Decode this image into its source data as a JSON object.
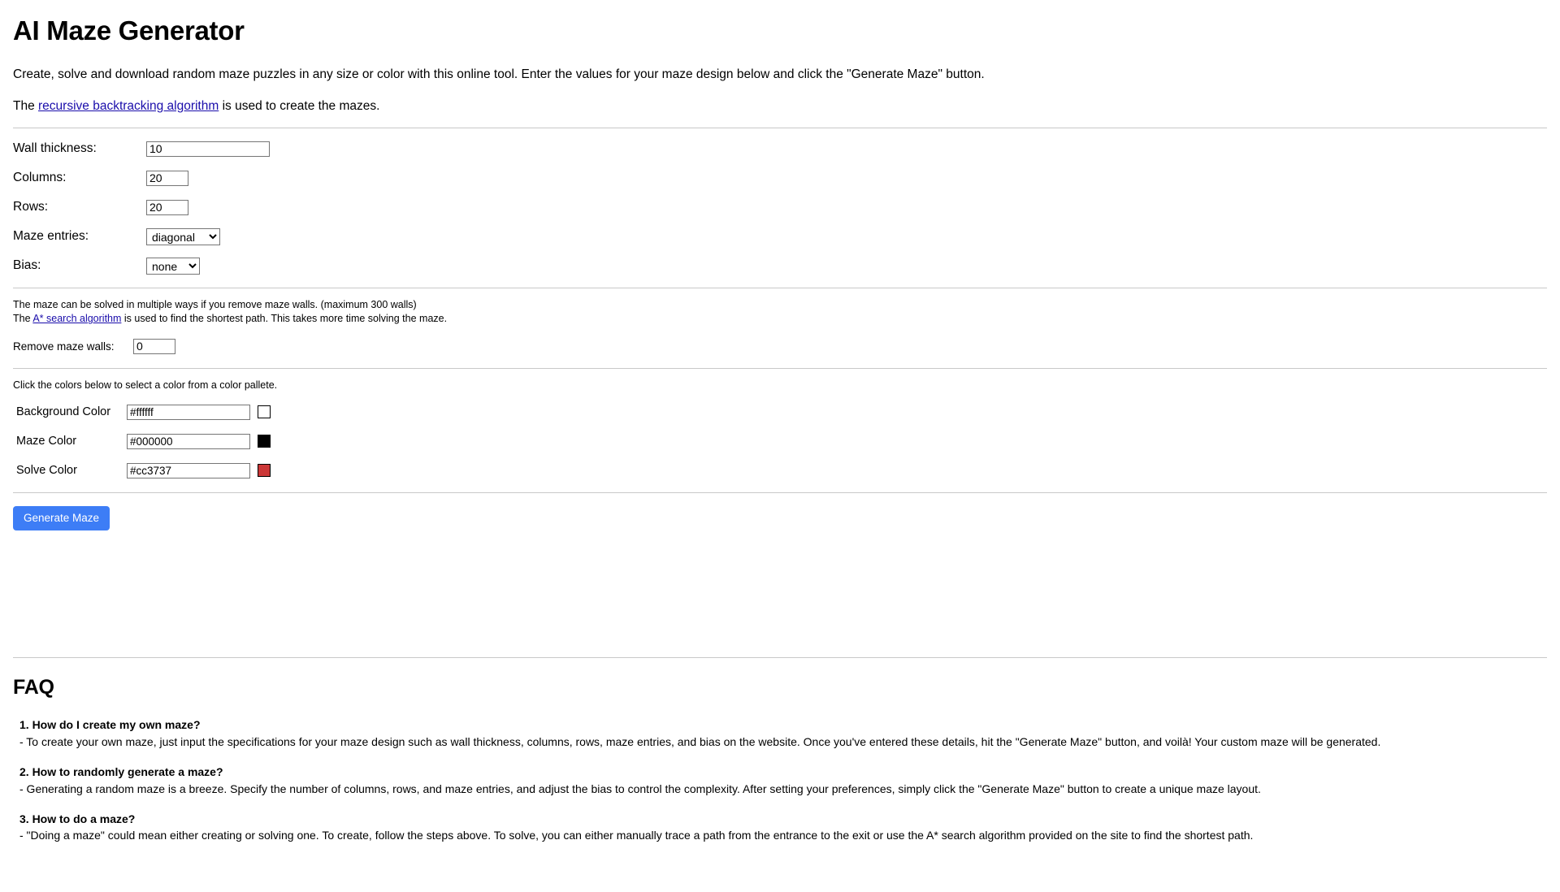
{
  "page": {
    "title": "AI Maze Generator",
    "intro": "Create, solve and download random maze puzzles in any size or color with this online tool. Enter the values for your maze design below and click the \"Generate Maze\" button.",
    "algorithm_prefix": "The ",
    "algorithm_link": "recursive backtracking algorithm",
    "algorithm_suffix": " is used to create the mazes."
  },
  "form": {
    "wall_thickness": {
      "label": "Wall thickness:",
      "value": "10"
    },
    "columns": {
      "label": "Columns:",
      "value": "20"
    },
    "rows": {
      "label": "Rows:",
      "value": "20"
    },
    "maze_entries": {
      "label": "Maze entries:",
      "value": "diagonal",
      "options": [
        "diagonal"
      ]
    },
    "bias": {
      "label": "Bias:",
      "value": "none",
      "options": [
        "none"
      ]
    }
  },
  "solve_section": {
    "note_line1": "The maze can be solved in multiple ways if you remove maze walls. (maximum 300 walls)",
    "note_line2_prefix": "The ",
    "note_line2_link": "A* search algorithm",
    "note_line2_suffix": " is used to find the shortest path. This takes more time solving the maze.",
    "remove_walls": {
      "label": "Remove maze walls:",
      "value": "0"
    }
  },
  "colors_section": {
    "note": "Click the colors below to select a color from a color pallete.",
    "rows": [
      {
        "label": "Background Color",
        "value": "#ffffff",
        "swatch": "#ffffff"
      },
      {
        "label": "Maze Color",
        "value": "#000000",
        "swatch": "#000000"
      },
      {
        "label": "Solve Color",
        "value": "#cc3737",
        "swatch": "#cc3737"
      }
    ]
  },
  "actions": {
    "generate_label": "Generate Maze",
    "generate_color": "#3d7df6"
  },
  "faq": {
    "heading": "FAQ",
    "items": [
      {
        "question": "1. How do I create my own maze?",
        "answer": "- To create your own maze, just input the specifications for your maze design such as wall thickness, columns, rows, maze entries, and bias on the website. Once you've entered these details, hit the \"Generate Maze\" button, and voilà! Your custom maze will be generated."
      },
      {
        "question": "2. How to randomly generate a maze?",
        "answer": "- Generating a random maze is a breeze. Specify the number of columns, rows, and maze entries, and adjust the bias to control the complexity. After setting your preferences, simply click the \"Generate Maze\" button to create a unique maze layout."
      },
      {
        "question": "3. How to do a maze?",
        "answer": "- \"Doing a maze\" could mean either creating or solving one. To create, follow the steps above. To solve, you can either manually trace a path from the entrance to the exit or use the A* search algorithm provided on the site to find the shortest path."
      }
    ]
  }
}
